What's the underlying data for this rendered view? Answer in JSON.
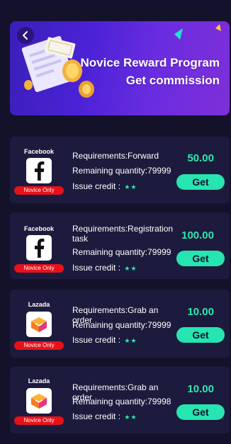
{
  "banner": {
    "title_line1": "Novice Reward Program",
    "title_line2": "Get commission"
  },
  "icons": {
    "back": "chevron-left-icon",
    "facebook": "facebook-icon",
    "lazada": "lazada-icon",
    "star": "star-icon"
  },
  "colors": {
    "accent": "#2ee9b0",
    "button": "#26e5b0",
    "badge": "#e8111a",
    "card": "#1d1b3d",
    "background": "#14122b"
  },
  "tasks": [
    {
      "platform": "Facebook",
      "badge": "Novice Only",
      "requirement": "Requirements:Forward",
      "remaining": "Remaining quantity:79999",
      "credit_label": "Issue credit :",
      "credit_stars": "★★",
      "amount": "50.00",
      "button": "Get"
    },
    {
      "platform": "Facebook",
      "badge": "Novice Only",
      "requirement": "Requirements:Registration task",
      "remaining": "Remaining quantity:79999",
      "credit_label": "Issue credit :",
      "credit_stars": "★★",
      "amount": "100.00",
      "button": "Get"
    },
    {
      "platform": "Lazada",
      "badge": "Novice Only",
      "requirement": "Requirements:Grab an order",
      "remaining": "Remaining quantity:79999",
      "credit_label": "Issue credit :",
      "credit_stars": "★★",
      "amount": "10.00",
      "button": "Get"
    },
    {
      "platform": "Lazada",
      "badge": "Novice Only",
      "requirement": "Requirements:Grab an order",
      "remaining": "Remaining quantity:79998",
      "credit_label": "Issue credit :",
      "credit_stars": "★★",
      "amount": "10.00",
      "button": "Get"
    }
  ]
}
